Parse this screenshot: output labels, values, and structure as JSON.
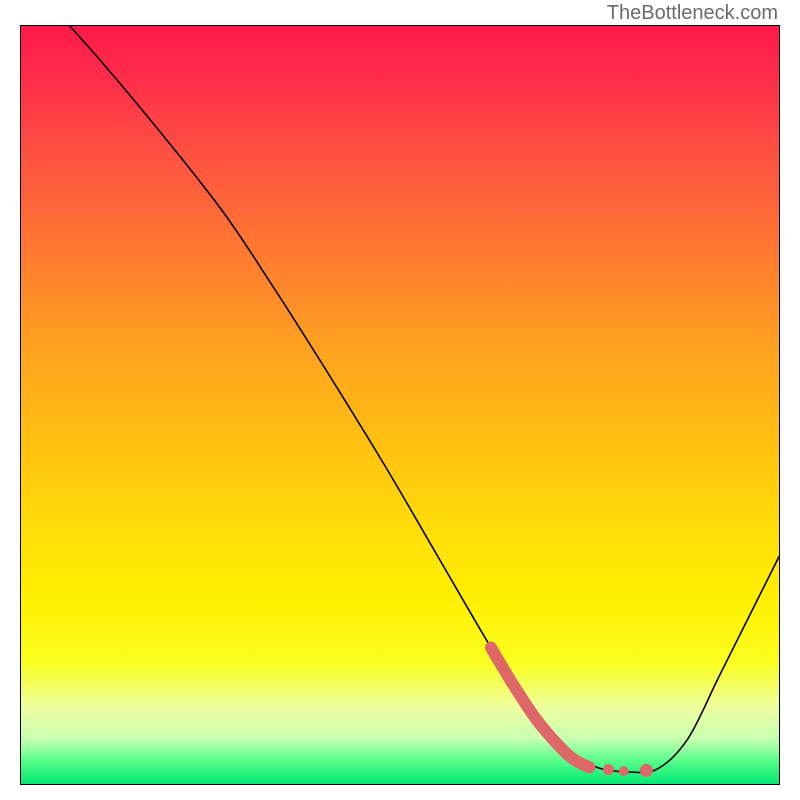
{
  "watermark": "TheBottleneck.com",
  "chart_data": {
    "type": "line",
    "title": "",
    "xlabel": "",
    "ylabel": "",
    "xlim": [
      0,
      100
    ],
    "ylim": [
      0,
      100
    ],
    "series": [
      {
        "name": "curve",
        "color": "#000000",
        "points": [
          {
            "x": 0,
            "y": 107
          },
          {
            "x": 10,
            "y": 96
          },
          {
            "x": 20,
            "y": 84
          },
          {
            "x": 27,
            "y": 75
          },
          {
            "x": 33,
            "y": 66
          },
          {
            "x": 40,
            "y": 55
          },
          {
            "x": 48,
            "y": 42
          },
          {
            "x": 55,
            "y": 30
          },
          {
            "x": 62,
            "y": 18
          },
          {
            "x": 67,
            "y": 10
          },
          {
            "x": 72,
            "y": 4.5
          },
          {
            "x": 76,
            "y": 2.2
          },
          {
            "x": 80,
            "y": 1.6
          },
          {
            "x": 84,
            "y": 2.0
          },
          {
            "x": 88,
            "y": 6
          },
          {
            "x": 92,
            "y": 14
          },
          {
            "x": 96,
            "y": 22
          },
          {
            "x": 100,
            "y": 30
          }
        ]
      },
      {
        "name": "highlight",
        "color": "#e06666",
        "points": [
          {
            "x": 62,
            "y": 18
          },
          {
            "x": 65,
            "y": 13
          },
          {
            "x": 68,
            "y": 8.5
          },
          {
            "x": 71,
            "y": 5
          },
          {
            "x": 73,
            "y": 3.2
          },
          {
            "x": 75,
            "y": 2.2
          }
        ]
      },
      {
        "name": "highlight-dots",
        "color": "#e06666",
        "points": [
          {
            "x": 77.5,
            "y": 1.9
          },
          {
            "x": 79.5,
            "y": 1.7
          },
          {
            "x": 82.5,
            "y": 1.8
          }
        ]
      }
    ]
  }
}
